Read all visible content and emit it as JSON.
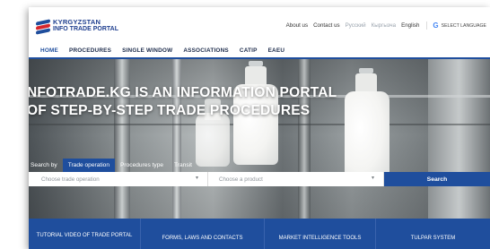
{
  "header": {
    "logo": {
      "line1": "KYRGYZSTAN",
      "line2": "INFO TRADE PORTAL"
    },
    "links": [
      {
        "label": "About us",
        "muted": false
      },
      {
        "label": "Contact us",
        "muted": false
      },
      {
        "label": "Русский",
        "muted": true
      },
      {
        "label": "Кыргызча",
        "muted": true
      },
      {
        "label": "English",
        "muted": false
      }
    ],
    "language_select": {
      "icon": "google-translate-icon",
      "label": "SELECT LANGUAGE"
    }
  },
  "nav": {
    "items": [
      "HOME",
      "PROCEDURES",
      "SINGLE WINDOW",
      "ASSOCIATIONS",
      "CATIP",
      "EAEU"
    ]
  },
  "hero": {
    "headline_line1": "NFOTRADE.KG IS AN INFORMATION PORTAL",
    "headline_line2": "OF STEP-BY-STEP TRADE PROCEDURES"
  },
  "search": {
    "tabs": [
      {
        "label": "Search by",
        "active": false
      },
      {
        "label": "Trade operation",
        "active": true
      },
      {
        "label": "Procedures type",
        "active": false
      },
      {
        "label": "Transit",
        "active": false
      }
    ],
    "field1": {
      "placeholder": "Choose trade operation",
      "arrow": "▾"
    },
    "field2": {
      "placeholder": "Choose a product",
      "arrow": "▾"
    },
    "button_label": "Search"
  },
  "bottom_tabs": [
    "TUTORIAL VIDEO OF TRADE PORTAL",
    "FORMS, LAWS AND CONTACTS",
    "MARKET INTELLIGENCE TOOLS",
    "TULPAR SYSTEM"
  ],
  "colors": {
    "brand_blue": "#1f4e9d",
    "accent_red": "#d6262c"
  }
}
